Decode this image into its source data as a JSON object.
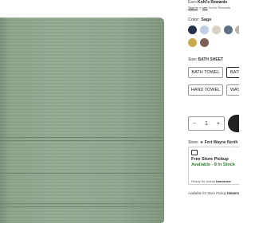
{
  "product": {
    "image_alt": "sage green bath towel",
    "color_label": "Color:",
    "color_value": "Sage",
    "swatches": [
      {
        "name": "navy",
        "color": "#27324d",
        "selected": false
      },
      {
        "name": "light-blue",
        "color": "#bdcde3",
        "selected": false
      },
      {
        "name": "taupe",
        "color": "#d9d1c4",
        "selected": false
      },
      {
        "name": "slate",
        "color": "#5e6f86",
        "selected": false
      },
      {
        "name": "mauve",
        "color": "#c0b1ab",
        "selected": false
      },
      {
        "name": "sage",
        "color": "#8ea88d",
        "selected": true
      },
      {
        "name": "mustard",
        "color": "#c9a94e",
        "selected": false
      },
      {
        "name": "brown",
        "color": "#7d5e52",
        "selected": false
      }
    ],
    "size_label": "Size:",
    "size_value": "BATH SHEET",
    "sizes": [
      {
        "label": "BATH TOWEL",
        "selected": false
      },
      {
        "label": "BATH SHEET",
        "selected": true
      },
      {
        "label": "HAND TOWEL",
        "selected": false
      },
      {
        "label": "WASHCLOTH",
        "selected": false
      }
    ]
  },
  "rewards": {
    "prefix": "Earn",
    "brand": "Kohl's Rewards",
    "signin_text": "Sign in",
    "or_text": "or",
    "see_text": "see",
    "suffix": "Kohl's Rewards"
  },
  "quantity": {
    "minus": "−",
    "value": "1",
    "plus": "+"
  },
  "store": {
    "label": "Store:",
    "name": "Fort Wayne North",
    "pickup_title": "Free Store Pickup",
    "stock_text": "Available - 8 In Stock",
    "ready_prefix": "Ready for pickup",
    "ready_day": "tomorrow",
    "avail_prefix": "Available for Store Pickup",
    "avail_day": "tomorrow"
  }
}
